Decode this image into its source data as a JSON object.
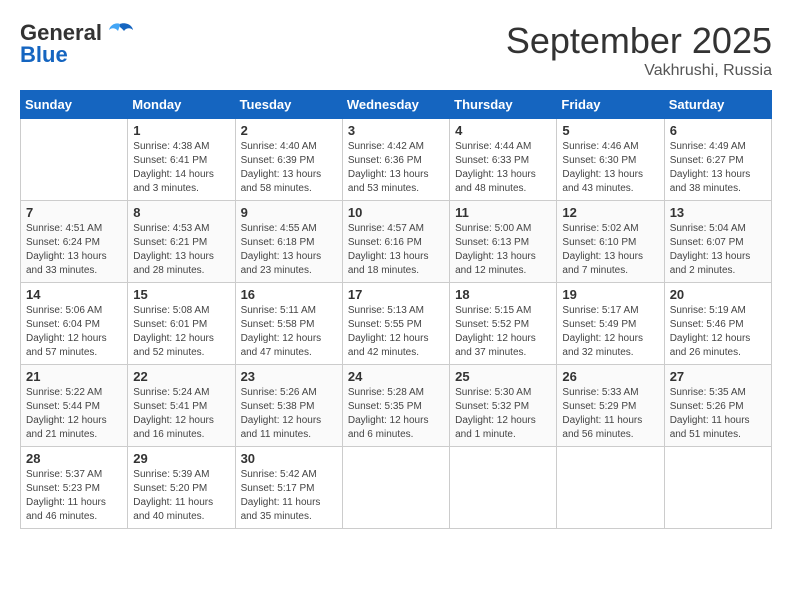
{
  "header": {
    "logo_line1": "General",
    "logo_line2": "Blue",
    "month": "September 2025",
    "location": "Vakhrushi, Russia"
  },
  "weekdays": [
    "Sunday",
    "Monday",
    "Tuesday",
    "Wednesday",
    "Thursday",
    "Friday",
    "Saturday"
  ],
  "weeks": [
    [
      {
        "day": "",
        "sunrise": "",
        "sunset": "",
        "daylight": ""
      },
      {
        "day": "1",
        "sunrise": "4:38 AM",
        "sunset": "6:41 PM",
        "daylight": "14 hours and 3 minutes."
      },
      {
        "day": "2",
        "sunrise": "4:40 AM",
        "sunset": "6:39 PM",
        "daylight": "13 hours and 58 minutes."
      },
      {
        "day": "3",
        "sunrise": "4:42 AM",
        "sunset": "6:36 PM",
        "daylight": "13 hours and 53 minutes."
      },
      {
        "day": "4",
        "sunrise": "4:44 AM",
        "sunset": "6:33 PM",
        "daylight": "13 hours and 48 minutes."
      },
      {
        "day": "5",
        "sunrise": "4:46 AM",
        "sunset": "6:30 PM",
        "daylight": "13 hours and 43 minutes."
      },
      {
        "day": "6",
        "sunrise": "4:49 AM",
        "sunset": "6:27 PM",
        "daylight": "13 hours and 38 minutes."
      }
    ],
    [
      {
        "day": "7",
        "sunrise": "4:51 AM",
        "sunset": "6:24 PM",
        "daylight": "13 hours and 33 minutes."
      },
      {
        "day": "8",
        "sunrise": "4:53 AM",
        "sunset": "6:21 PM",
        "daylight": "13 hours and 28 minutes."
      },
      {
        "day": "9",
        "sunrise": "4:55 AM",
        "sunset": "6:18 PM",
        "daylight": "13 hours and 23 minutes."
      },
      {
        "day": "10",
        "sunrise": "4:57 AM",
        "sunset": "6:16 PM",
        "daylight": "13 hours and 18 minutes."
      },
      {
        "day": "11",
        "sunrise": "5:00 AM",
        "sunset": "6:13 PM",
        "daylight": "13 hours and 12 minutes."
      },
      {
        "day": "12",
        "sunrise": "5:02 AM",
        "sunset": "6:10 PM",
        "daylight": "13 hours and 7 minutes."
      },
      {
        "day": "13",
        "sunrise": "5:04 AM",
        "sunset": "6:07 PM",
        "daylight": "13 hours and 2 minutes."
      }
    ],
    [
      {
        "day": "14",
        "sunrise": "5:06 AM",
        "sunset": "6:04 PM",
        "daylight": "12 hours and 57 minutes."
      },
      {
        "day": "15",
        "sunrise": "5:08 AM",
        "sunset": "6:01 PM",
        "daylight": "12 hours and 52 minutes."
      },
      {
        "day": "16",
        "sunrise": "5:11 AM",
        "sunset": "5:58 PM",
        "daylight": "12 hours and 47 minutes."
      },
      {
        "day": "17",
        "sunrise": "5:13 AM",
        "sunset": "5:55 PM",
        "daylight": "12 hours and 42 minutes."
      },
      {
        "day": "18",
        "sunrise": "5:15 AM",
        "sunset": "5:52 PM",
        "daylight": "12 hours and 37 minutes."
      },
      {
        "day": "19",
        "sunrise": "5:17 AM",
        "sunset": "5:49 PM",
        "daylight": "12 hours and 32 minutes."
      },
      {
        "day": "20",
        "sunrise": "5:19 AM",
        "sunset": "5:46 PM",
        "daylight": "12 hours and 26 minutes."
      }
    ],
    [
      {
        "day": "21",
        "sunrise": "5:22 AM",
        "sunset": "5:44 PM",
        "daylight": "12 hours and 21 minutes."
      },
      {
        "day": "22",
        "sunrise": "5:24 AM",
        "sunset": "5:41 PM",
        "daylight": "12 hours and 16 minutes."
      },
      {
        "day": "23",
        "sunrise": "5:26 AM",
        "sunset": "5:38 PM",
        "daylight": "12 hours and 11 minutes."
      },
      {
        "day": "24",
        "sunrise": "5:28 AM",
        "sunset": "5:35 PM",
        "daylight": "12 hours and 6 minutes."
      },
      {
        "day": "25",
        "sunrise": "5:30 AM",
        "sunset": "5:32 PM",
        "daylight": "12 hours and 1 minute."
      },
      {
        "day": "26",
        "sunrise": "5:33 AM",
        "sunset": "5:29 PM",
        "daylight": "11 hours and 56 minutes."
      },
      {
        "day": "27",
        "sunrise": "5:35 AM",
        "sunset": "5:26 PM",
        "daylight": "11 hours and 51 minutes."
      }
    ],
    [
      {
        "day": "28",
        "sunrise": "5:37 AM",
        "sunset": "5:23 PM",
        "daylight": "11 hours and 46 minutes."
      },
      {
        "day": "29",
        "sunrise": "5:39 AM",
        "sunset": "5:20 PM",
        "daylight": "11 hours and 40 minutes."
      },
      {
        "day": "30",
        "sunrise": "5:42 AM",
        "sunset": "5:17 PM",
        "daylight": "11 hours and 35 minutes."
      },
      {
        "day": "",
        "sunrise": "",
        "sunset": "",
        "daylight": ""
      },
      {
        "day": "",
        "sunrise": "",
        "sunset": "",
        "daylight": ""
      },
      {
        "day": "",
        "sunrise": "",
        "sunset": "",
        "daylight": ""
      },
      {
        "day": "",
        "sunrise": "",
        "sunset": "",
        "daylight": ""
      }
    ]
  ]
}
